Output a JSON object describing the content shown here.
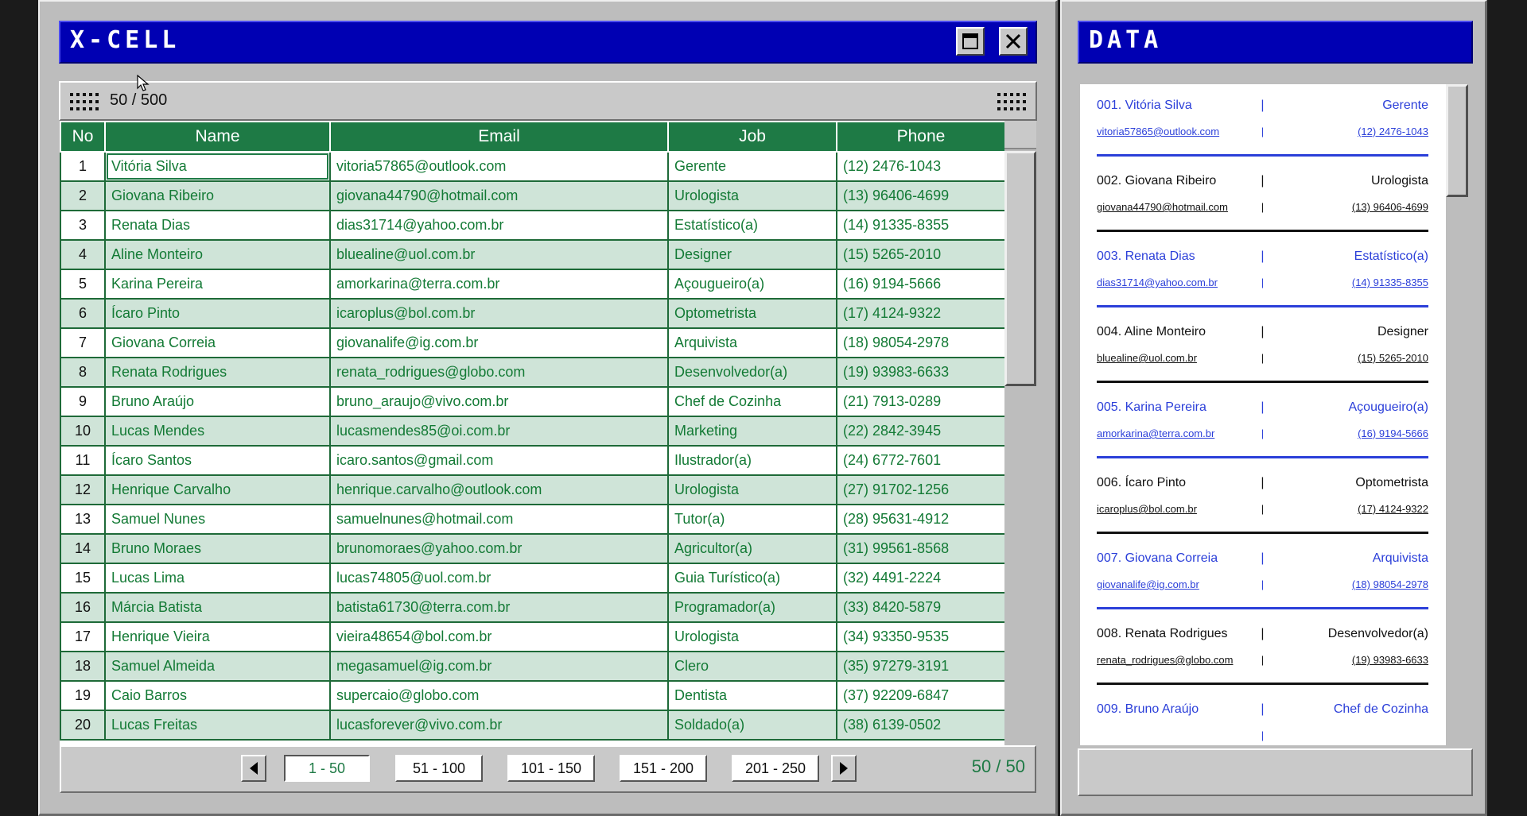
{
  "xcell": {
    "title": "X-CELL",
    "counter": "50 / 500",
    "columns": [
      "No",
      "Name",
      "Email",
      "Job",
      "Phone"
    ],
    "rows": [
      {
        "no": "1",
        "name": "Vitória Silva",
        "email": "vitoria57865@outlook.com",
        "job": "Gerente",
        "phone": "(12) 2476-1043"
      },
      {
        "no": "2",
        "name": "Giovana Ribeiro",
        "email": "giovana44790@hotmail.com",
        "job": "Urologista",
        "phone": "(13) 96406-4699"
      },
      {
        "no": "3",
        "name": "Renata Dias",
        "email": "dias31714@yahoo.com.br",
        "job": "Estatístico(a)",
        "phone": "(14) 91335-8355"
      },
      {
        "no": "4",
        "name": "Aline Monteiro",
        "email": "bluealine@uol.com.br",
        "job": "Designer",
        "phone": "(15) 5265-2010"
      },
      {
        "no": "5",
        "name": "Karina Pereira",
        "email": "amorkarina@terra.com.br",
        "job": "Açougueiro(a)",
        "phone": "(16) 9194-5666"
      },
      {
        "no": "6",
        "name": "Ícaro Pinto",
        "email": "icaroplus@bol.com.br",
        "job": "Optometrista",
        "phone": "(17) 4124-9322"
      },
      {
        "no": "7",
        "name": "Giovana Correia",
        "email": "giovanalife@ig.com.br",
        "job": "Arquivista",
        "phone": "(18) 98054-2978"
      },
      {
        "no": "8",
        "name": "Renata Rodrigues",
        "email": "renata_rodrigues@globo.com",
        "job": "Desenvolvedor(a)",
        "phone": "(19) 93983-6633"
      },
      {
        "no": "9",
        "name": "Bruno Araújo",
        "email": "bruno_araujo@vivo.com.br",
        "job": "Chef de Cozinha",
        "phone": "(21) 7913-0289"
      },
      {
        "no": "10",
        "name": "Lucas Mendes",
        "email": "lucasmendes85@oi.com.br",
        "job": "Marketing",
        "phone": "(22) 2842-3945"
      },
      {
        "no": "11",
        "name": "Ícaro Santos",
        "email": "icaro.santos@gmail.com",
        "job": "Ilustrador(a)",
        "phone": "(24) 6772-7601"
      },
      {
        "no": "12",
        "name": "Henrique Carvalho",
        "email": "henrique.carvalho@outlook.com",
        "job": "Urologista",
        "phone": "(27) 91702-1256"
      },
      {
        "no": "13",
        "name": "Samuel Nunes",
        "email": "samuelnunes@hotmail.com",
        "job": "Tutor(a)",
        "phone": "(28) 95631-4912"
      },
      {
        "no": "14",
        "name": "Bruno Moraes",
        "email": "brunomoraes@yahoo.com.br",
        "job": "Agricultor(a)",
        "phone": "(31) 99561-8568"
      },
      {
        "no": "15",
        "name": "Lucas Lima",
        "email": "lucas74805@uol.com.br",
        "job": "Guia Turístico(a)",
        "phone": "(32) 4491-2224"
      },
      {
        "no": "16",
        "name": "Márcia Batista",
        "email": "batista61730@terra.com.br",
        "job": "Programador(a)",
        "phone": "(33) 8420-5879"
      },
      {
        "no": "17",
        "name": "Henrique Vieira",
        "email": "vieira48654@bol.com.br",
        "job": "Urologista",
        "phone": "(34) 93350-9535"
      },
      {
        "no": "18",
        "name": "Samuel Almeida",
        "email": "megasamuel@ig.com.br",
        "job": "Clero",
        "phone": "(35) 97279-3191"
      },
      {
        "no": "19",
        "name": "Caio Barros",
        "email": "supercaio@globo.com",
        "job": "Dentista",
        "phone": "(37) 92209-6847"
      },
      {
        "no": "20",
        "name": "Lucas Freitas",
        "email": "lucasforever@vivo.com.br",
        "job": "Soldado(a)",
        "phone": "(38) 6139-0502"
      }
    ],
    "pages": [
      "1 - 50",
      "51 - 100",
      "101 - 150",
      "151 - 200",
      "201 - 250"
    ],
    "active_page": 0,
    "page_count": "50 / 50"
  },
  "data_window": {
    "title": "DATA",
    "cards": [
      {
        "label": "001. Vitória Silva",
        "job": "Gerente",
        "email": "vitoria57865@outlook.com",
        "phone": "(12) 2476-1043",
        "sep": "|"
      },
      {
        "label": "002. Giovana Ribeiro",
        "job": "Urologista",
        "email": "giovana44790@hotmail.com",
        "phone": "(13) 96406-4699",
        "sep": "|"
      },
      {
        "label": "003. Renata Dias",
        "job": "Estatístico(a)",
        "email": "dias31714@yahoo.com.br",
        "phone": "(14) 91335-8355",
        "sep": "|"
      },
      {
        "label": "004. Aline Monteiro",
        "job": "Designer",
        "email": "bluealine@uol.com.br",
        "phone": "(15) 5265-2010",
        "sep": "|"
      },
      {
        "label": "005. Karina Pereira",
        "job": "Açougueiro(a)",
        "email": "amorkarina@terra.com.br",
        "phone": "(16) 9194-5666",
        "sep": "|"
      },
      {
        "label": "006. Ícaro Pinto",
        "job": "Optometrista",
        "email": "icaroplus@bol.com.br",
        "phone": "(17) 4124-9322",
        "sep": "|"
      },
      {
        "label": "007. Giovana Correia",
        "job": "Arquivista",
        "email": "giovanalife@ig.com.br",
        "phone": "(18) 98054-2978",
        "sep": "|"
      },
      {
        "label": "008. Renata Rodrigues",
        "job": "Desenvolvedor(a)",
        "email": "renata_rodrigues@globo.com",
        "phone": "(19) 93983-6633",
        "sep": "|"
      },
      {
        "label": "009. Bruno Araújo",
        "job": "Chef de Cozinha",
        "email": "",
        "phone": "",
        "sep": "|"
      }
    ]
  },
  "colors": {
    "title_blue": "#0000b3",
    "grid_green": "#1e7a45",
    "row_tint": "#cfe4d8",
    "card_blue": "#2b3fd9"
  },
  "icons": [
    "grip-icon",
    "maximize-icon",
    "close-icon",
    "arrow-left-icon",
    "arrow-right-icon",
    "cursor-icon"
  ]
}
